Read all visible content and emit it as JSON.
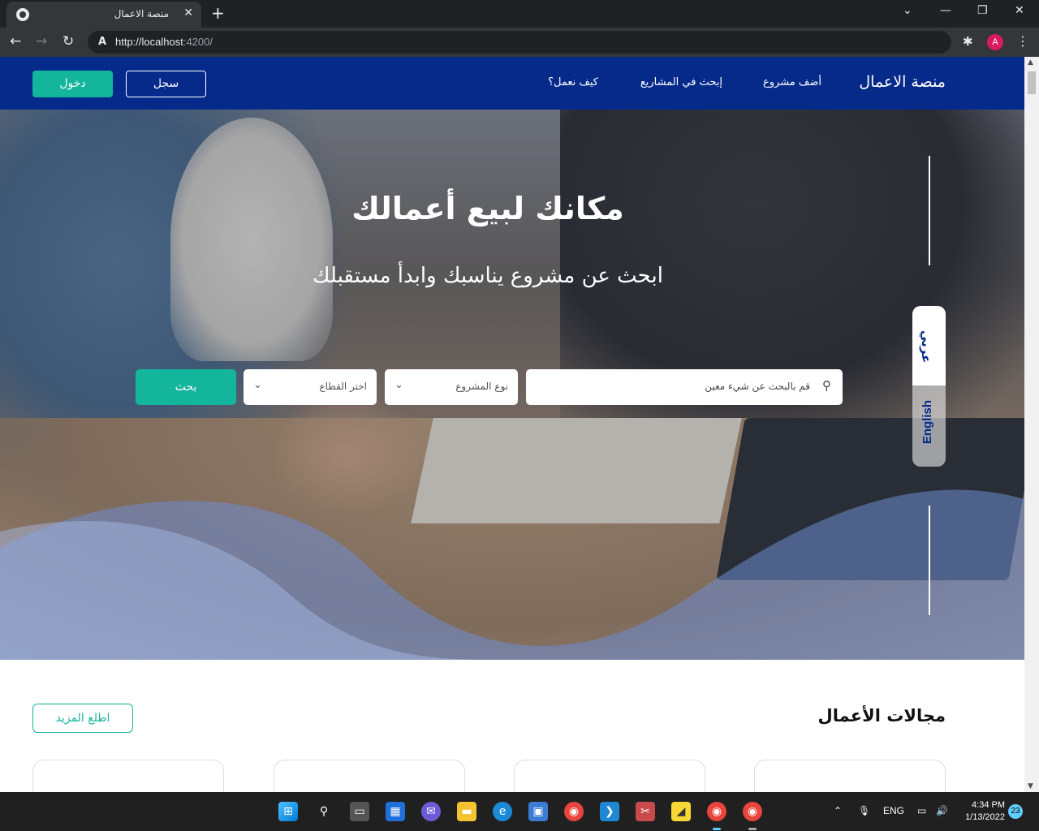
{
  "browser": {
    "tab_title": "منصة الاعمال",
    "tab_close": "✕",
    "new_tab": "+",
    "url_host": "http://localhost",
    "url_rest": ":4200/",
    "profile_initial": "A",
    "window_minimize": "—",
    "window_restore": "❐",
    "window_close": "✕",
    "tab_search": "⌄"
  },
  "navbar": {
    "brand": "منصة الاعمال",
    "links": [
      "أضف مشروع",
      "إبحث في المشاريع",
      "كيف نعمل؟"
    ],
    "register_label": "سجل",
    "login_label": "دخول"
  },
  "hero": {
    "title": "مكانك لبيع أعمالك",
    "subtitle": "ابحث عن مشروع يناسبك وابدأ مستقبلك",
    "search_placeholder": "قم بالبحث عن شيء معين",
    "project_type": "نوع المشروع",
    "sector": "اختر القطاع",
    "search_button": "بحث"
  },
  "language": {
    "arabic": "عربي",
    "english": "English"
  },
  "section": {
    "title": "مجالات الأعمال",
    "more_button": "اطلع المزيد"
  },
  "taskbar": {
    "language": "ENG",
    "time": "4:34 PM",
    "date": "1/13/2022",
    "notifications": "23"
  },
  "colors": {
    "brand_blue": "#062a8a",
    "accent_green": "#13b59b"
  }
}
